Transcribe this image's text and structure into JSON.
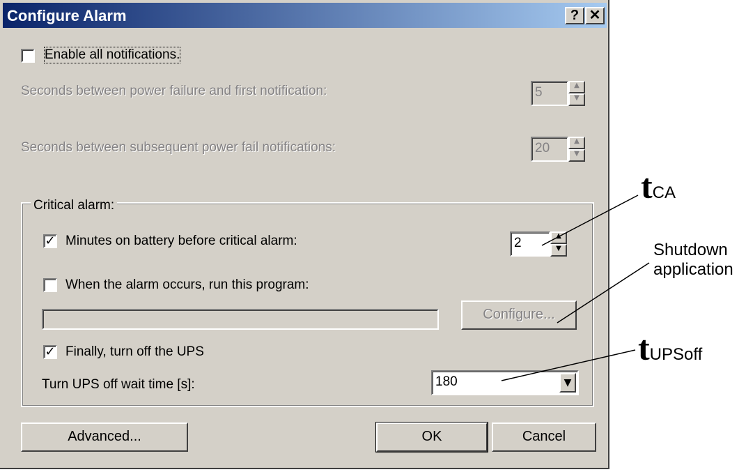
{
  "window": {
    "title": "Configure Alarm",
    "help_btn": "?",
    "close_btn": "✕"
  },
  "enable_all": {
    "label": "Enable all notifications.",
    "checked": false
  },
  "first_notification": {
    "label": "Seconds between power failure and first notification:",
    "value": "5"
  },
  "subsequent_notification": {
    "label": "Seconds between subsequent power fail notifications:",
    "value": "20"
  },
  "critical": {
    "legend": "Critical alarm:",
    "minutes_label": "Minutes on battery before critical alarm:",
    "minutes_checked": true,
    "minutes_value": "2",
    "run_program_label": "When the alarm occurs, run this program:",
    "run_program_checked": false,
    "program_path": "",
    "configure_label": "Configure...",
    "turn_off_label": "Finally, turn off the UPS",
    "turn_off_checked": true,
    "wait_label": "Turn UPS off wait time [s]:",
    "wait_value": "180"
  },
  "buttons": {
    "advanced": "Advanced...",
    "ok": "OK",
    "cancel": "Cancel"
  },
  "annotations": {
    "tca_t": "t",
    "tca_sub": "CA",
    "shutdown_line1": "Shutdown",
    "shutdown_line2": "application",
    "tups_t": "t",
    "tups_sub": "UPSoff"
  },
  "colors": {
    "dialog_bg": "#d4d0c8",
    "title_start": "#0a246a",
    "title_end": "#a6caf0",
    "disabled_text": "#848284"
  }
}
